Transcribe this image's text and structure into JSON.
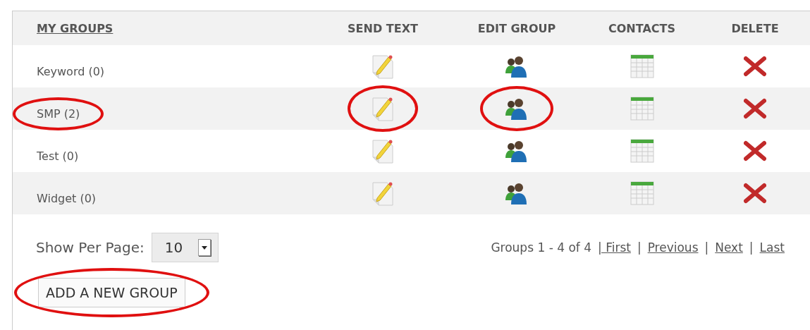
{
  "columns": [
    {
      "label": "MY GROUPS",
      "underlined": true
    },
    {
      "label": "SEND TEXT",
      "underlined": false
    },
    {
      "label": "EDIT GROUP",
      "underlined": false
    },
    {
      "label": "CONTACTS",
      "underlined": false
    },
    {
      "label": "DELETE",
      "underlined": false
    }
  ],
  "rows": [
    {
      "name": "Keyword (0)",
      "name_circled": false,
      "send_circled": false,
      "edit_circled": false
    },
    {
      "name": "SMP (2)",
      "name_circled": true,
      "send_circled": true,
      "edit_circled": true
    },
    {
      "name": "Test (0)",
      "name_circled": false,
      "send_circled": false,
      "edit_circled": false
    },
    {
      "name": "Widget (0)",
      "name_circled": false,
      "send_circled": false,
      "edit_circled": false
    }
  ],
  "per_page": {
    "label": "Show Per Page:",
    "value": "10"
  },
  "pagination": {
    "summary": "Groups 1 - 4 of 4",
    "links": [
      "| First",
      "Previous",
      "Next",
      "Last"
    ],
    "separator": "|"
  },
  "add_button": {
    "label": "ADD A NEW GROUP",
    "circled": true
  }
}
